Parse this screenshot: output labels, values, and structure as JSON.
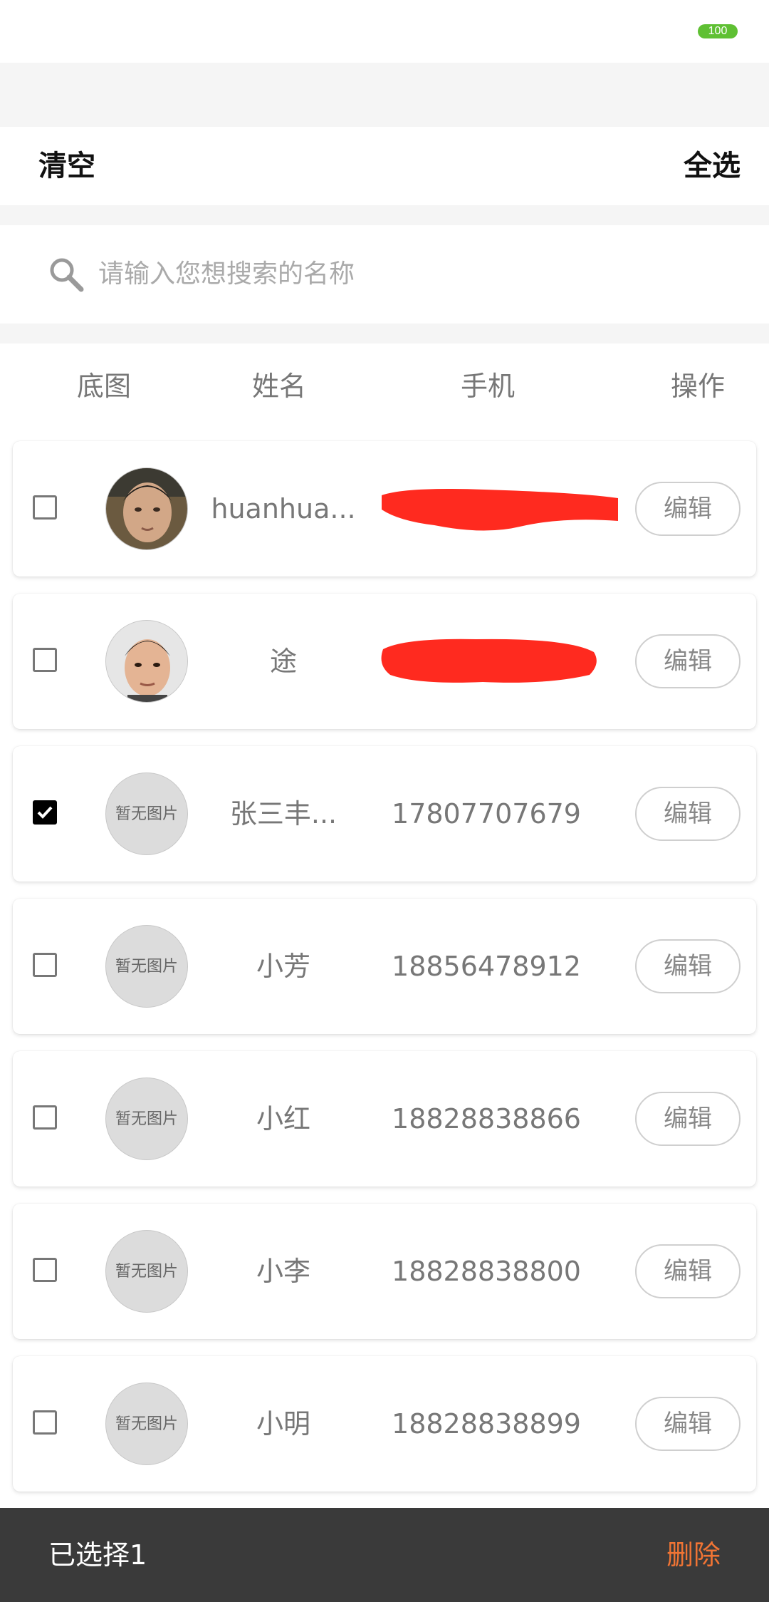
{
  "status_bar": {
    "battery": "100"
  },
  "toolbar": {
    "clear_label": "清空",
    "select_all_label": "全选"
  },
  "search": {
    "placeholder": "请输入您想搜索的名称"
  },
  "table_header": {
    "col_image": "底图",
    "col_name": "姓名",
    "col_phone": "手机",
    "col_action": "操作"
  },
  "rows": [
    {
      "checked": false,
      "has_photo": true,
      "no_image_text": "",
      "name": "huanhua...",
      "phone": "",
      "phone_redacted": true,
      "edit_label": "编辑"
    },
    {
      "checked": false,
      "has_photo": true,
      "no_image_text": "",
      "name": "途",
      "phone": "",
      "phone_redacted": true,
      "edit_label": "编辑"
    },
    {
      "checked": true,
      "has_photo": false,
      "no_image_text": "暂无图片",
      "name": "张三丰...",
      "phone": "17807707679",
      "phone_redacted": false,
      "edit_label": "编辑"
    },
    {
      "checked": false,
      "has_photo": false,
      "no_image_text": "暂无图片",
      "name": "小芳",
      "phone": "18856478912",
      "phone_redacted": false,
      "edit_label": "编辑"
    },
    {
      "checked": false,
      "has_photo": false,
      "no_image_text": "暂无图片",
      "name": "小红",
      "phone": "18828838866",
      "phone_redacted": false,
      "edit_label": "编辑"
    },
    {
      "checked": false,
      "has_photo": false,
      "no_image_text": "暂无图片",
      "name": "小李",
      "phone": "18828838800",
      "phone_redacted": false,
      "edit_label": "编辑"
    },
    {
      "checked": false,
      "has_photo": false,
      "no_image_text": "暂无图片",
      "name": "小明",
      "phone": "18828838899",
      "phone_redacted": false,
      "edit_label": "编辑"
    }
  ],
  "footer": {
    "selected_label": "已选择1",
    "delete_label": "删除"
  },
  "colors": {
    "battery": "#5fc033",
    "delete_accent": "#f07434",
    "footer_bg": "#3a3a3a",
    "redaction": "#ff2a1f"
  }
}
